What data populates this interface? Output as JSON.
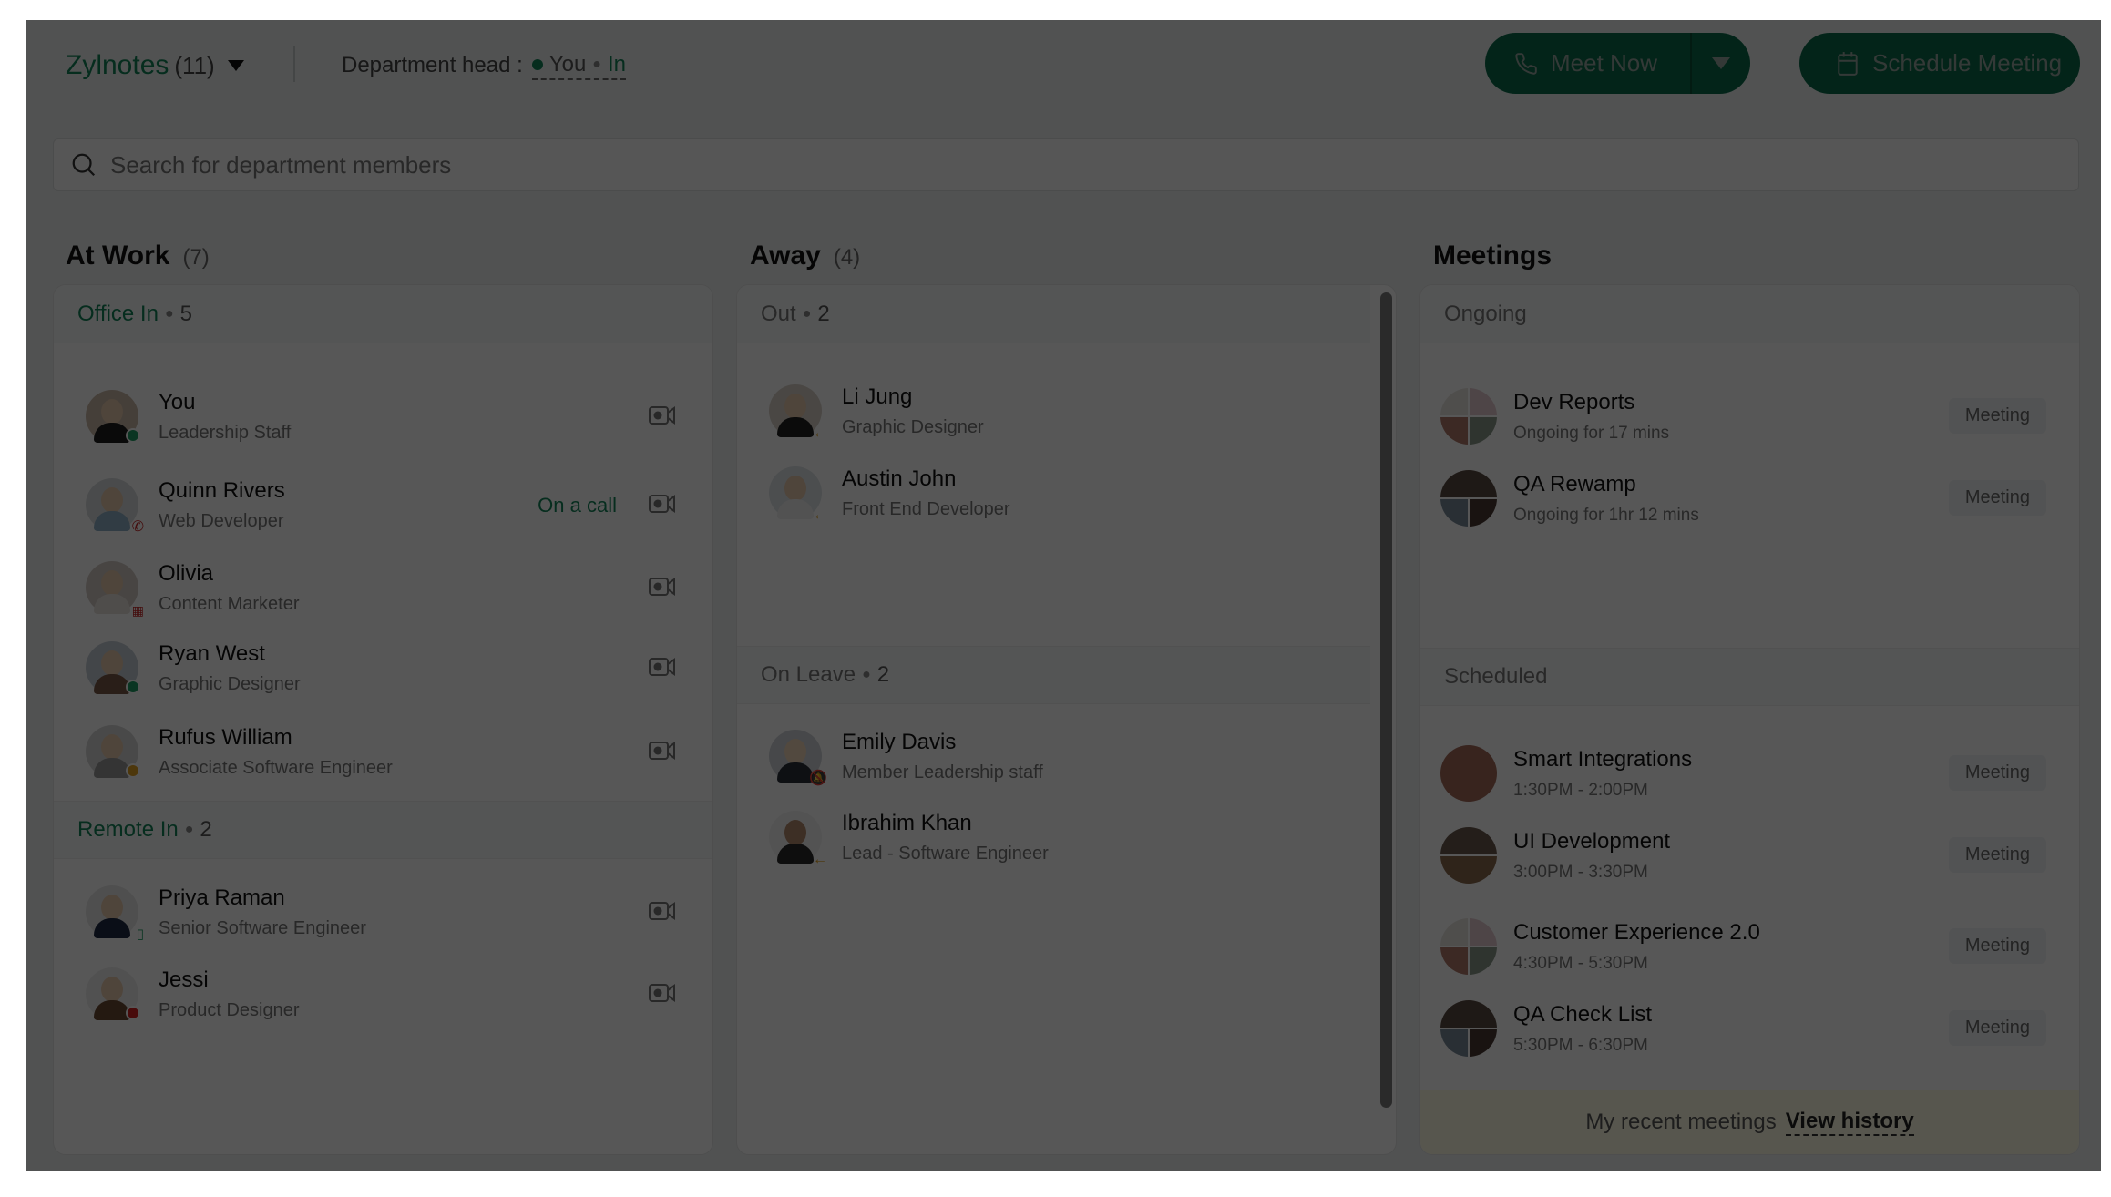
{
  "header": {
    "department_name": "Zylnotes",
    "department_count": "(11)",
    "department_head_label": "Department head :",
    "department_head_value": "You",
    "department_head_status": "In",
    "meet_now_label": "Meet Now",
    "schedule_meeting_label": "Schedule Meeting"
  },
  "search": {
    "placeholder": "Search for department members",
    "value": ""
  },
  "colors": {
    "accent": "#13845a",
    "button": "#0b6b4a",
    "online": "#13845a",
    "busy": "#c62828",
    "away": "#e0a020",
    "footer_bg": "#fffbe5"
  },
  "at_work": {
    "title": "At Work",
    "count": "(7)",
    "office_in": {
      "label": "Office In",
      "count": "5",
      "members": [
        {
          "name": "You",
          "role": "Leadership Staff",
          "status": "online",
          "status_icon": "dot",
          "call_status": ""
        },
        {
          "name": "Quinn Rivers",
          "role": "Web Developer",
          "status": "busy",
          "status_icon": "phone-icon",
          "call_status": "On a call"
        },
        {
          "name": "Olivia",
          "role": "Content Marketer",
          "status": "busy",
          "status_icon": "calendar-icon",
          "call_status": ""
        },
        {
          "name": "Ryan West",
          "role": "Graphic Designer",
          "status": "online",
          "status_icon": "dot",
          "call_status": ""
        },
        {
          "name": "Rufus William",
          "role": "Associate Software Engineer",
          "status": "away",
          "status_icon": "dot",
          "call_status": ""
        }
      ]
    },
    "remote_in": {
      "label": "Remote In",
      "count": "2",
      "members": [
        {
          "name": "Priya Raman",
          "role": "Senior Software Engineer",
          "status": "online",
          "status_icon": "mobile-icon"
        },
        {
          "name": "Jessi",
          "role": "Product Designer",
          "status": "busy",
          "status_icon": "dot"
        }
      ]
    }
  },
  "away": {
    "title": "Away",
    "count": "(4)",
    "out": {
      "label": "Out",
      "count": "2",
      "members": [
        {
          "name": "Li Jung",
          "role": "Graphic Designer",
          "status_icon": "arrow-left-icon"
        },
        {
          "name": "Austin John",
          "role": "Front End Developer",
          "status_icon": "arrow-left-icon"
        }
      ]
    },
    "on_leave": {
      "label": "On Leave",
      "count": "2",
      "members": [
        {
          "name": "Emily Davis",
          "role": "Member Leadership staff",
          "status_icon": "bell-off-icon"
        },
        {
          "name": "Ibrahim Khan",
          "role": "Lead - Software Engineer",
          "status_icon": "arrow-left-icon"
        }
      ]
    }
  },
  "meetings": {
    "title": "Meetings",
    "ongoing_label": "Ongoing",
    "ongoing": [
      {
        "title": "Dev Reports",
        "subtitle": "Ongoing for 17 mins",
        "tag": "Meeting"
      },
      {
        "title": "QA Rewamp",
        "subtitle": "Ongoing for 1hr 12 mins",
        "tag": "Meeting"
      }
    ],
    "scheduled_label": "Scheduled",
    "scheduled": [
      {
        "title": "Smart Integrations",
        "subtitle": "1:30PM - 2:00PM",
        "tag": "Meeting"
      },
      {
        "title": "UI Development",
        "subtitle": "3:00PM - 3:30PM",
        "tag": "Meeting"
      },
      {
        "title": "Customer Experience 2.0",
        "subtitle": "4:30PM - 5:30PM",
        "tag": "Meeting"
      },
      {
        "title": "QA Check List",
        "subtitle": "5:30PM - 6:30PM",
        "tag": "Meeting"
      }
    ],
    "footer_text": "My recent meetings",
    "footer_link": "View history"
  }
}
